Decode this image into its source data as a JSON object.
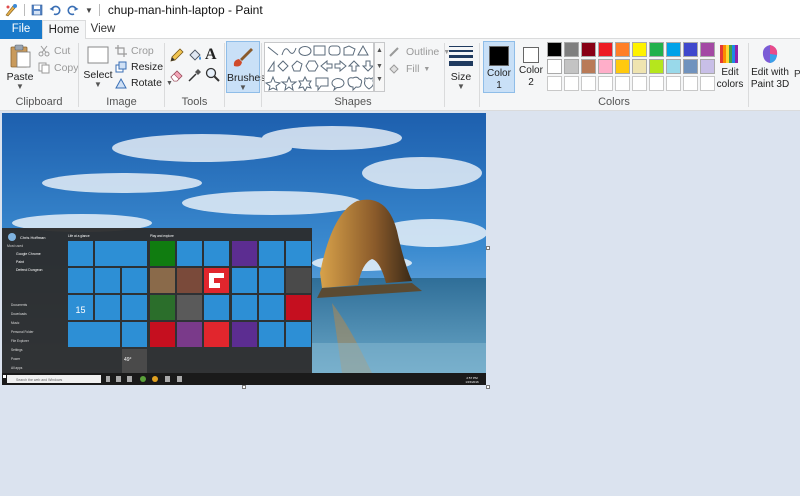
{
  "window": {
    "title": "chup-man-hinh-laptop - Paint"
  },
  "quick_access": {
    "icons": [
      "paint-app-icon",
      "save-icon",
      "undo-icon",
      "redo-icon",
      "customize-qat-icon"
    ]
  },
  "tabs": {
    "file": "File",
    "home": "Home",
    "view": "View"
  },
  "clipboard": {
    "label": "Clipboard",
    "paste": "Paste",
    "cut": "Cut",
    "copy": "Copy"
  },
  "image": {
    "label": "Image",
    "select": "Select",
    "crop": "Crop",
    "resize": "Resize",
    "rotate": "Rotate"
  },
  "tools": {
    "label": "Tools",
    "brushes": "Brushes"
  },
  "shapes": {
    "label": "Shapes",
    "outline": "Outline",
    "fill": "Fill",
    "size": "Size"
  },
  "colors": {
    "label": "Colors",
    "color1": "Color 1",
    "color2": "Color 2",
    "edit_colors": "Edit colors",
    "edit_paint3d": "Edit with Paint 3D",
    "color1_value": "#000000",
    "color2_value": "#ffffff",
    "palette_row1": [
      "#000000",
      "#7f7f7f",
      "#880015",
      "#ed1c24",
      "#ff7f27",
      "#fff200",
      "#22b14c",
      "#00a2e8",
      "#3f48cc",
      "#a349a4"
    ],
    "palette_row2": [
      "#ffffff",
      "#c3c3c3",
      "#b97a57",
      "#ffaec9",
      "#ffc90e",
      "#efe4b0",
      "#b5e61d",
      "#99d9ea",
      "#7092be",
      "#c8bfe7"
    ],
    "palette_row3": [
      "#ffffff",
      "#ffffff",
      "#ffffff",
      "#ffffff",
      "#ffffff",
      "#ffffff",
      "#ffffff",
      "#ffffff",
      "#ffffff",
      "#ffffff"
    ]
  },
  "screenshot": {
    "start_user": "Chris Hoffman",
    "most_used": "Most used",
    "apps": [
      "Google Chrome",
      "Paint",
      "Defend Dungeon"
    ],
    "places": [
      "Documents",
      "Downloads",
      "Music",
      "Personal Folder",
      "File Explorer",
      "Settings",
      "Power",
      "All apps"
    ],
    "life_header": "Life at a glance",
    "play_header": "Play and explore",
    "calendar_day": "15",
    "weather_temp": "49°",
    "search_placeholder": "Search the web and Windows",
    "clock_time": "2:57 PM",
    "clock_date": "1/15/2016"
  }
}
